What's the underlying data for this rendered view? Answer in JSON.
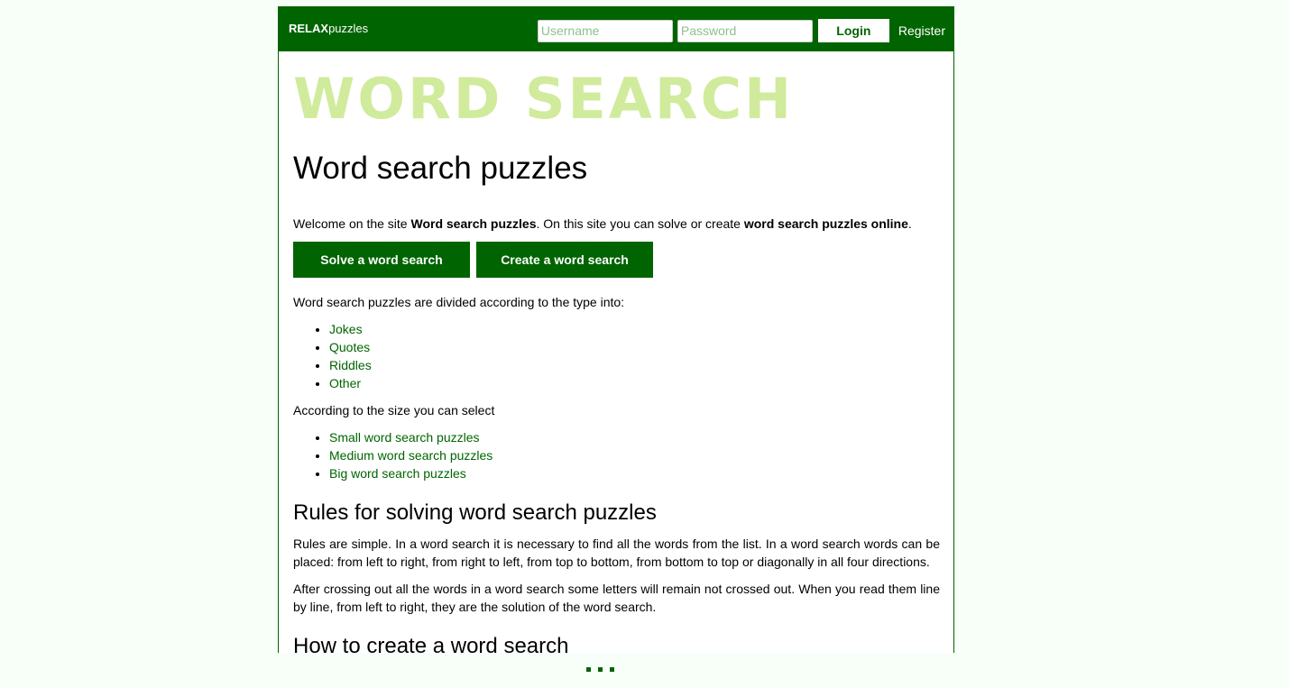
{
  "header": {
    "logo_bold": "RELAX",
    "logo_rest": "puzzles",
    "username_placeholder": "Username",
    "password_placeholder": "Password",
    "login_label": "Login",
    "register_label": "Register"
  },
  "main": {
    "banner": "WORD SEARCH",
    "title": "Word search puzzles",
    "welcome": {
      "part1": "Welcome on the site ",
      "bold1": "Word search puzzles",
      "part2": ". On this site you can solve or create ",
      "bold2": "word search puzzles online",
      "part3": "."
    },
    "buttons": {
      "solve": "Solve a word search",
      "create": "Create a word search"
    },
    "types_intro": "Word search puzzles are divided according to the type into:",
    "types": [
      "Jokes",
      "Quotes",
      "Riddles",
      "Other"
    ],
    "sizes_intro": "According to the size you can select",
    "sizes": [
      "Small word search puzzles",
      "Medium word search puzzles",
      "Big word search puzzles"
    ],
    "rules_heading": "Rules for solving word search puzzles",
    "rules_p1": "Rules are simple. In a word search it is necessary to find all the words from the list. In a word search words can be placed: from left to right, from right to left, from top to bottom, from bottom to top or diagonally in all four directions.",
    "rules_p2": "After crossing out all the words in a word search some letters will remain not crossed out. When you read them line by line, from left to right, they are the solution of the word search.",
    "create_heading": "How to create a word search"
  },
  "colors": {
    "brand": "#006400",
    "banner": "#d0eb9c",
    "background": "#f8fff8"
  },
  "loading_indicator": "more-content-dots"
}
